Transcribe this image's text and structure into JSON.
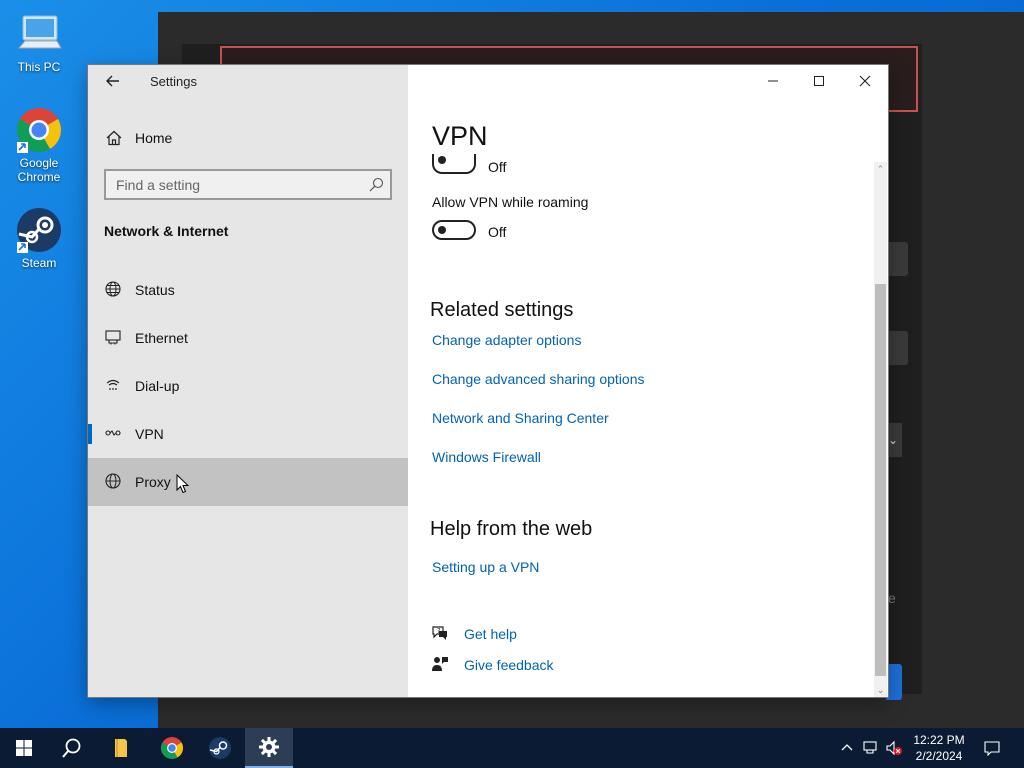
{
  "desktop": {
    "icons": [
      {
        "label": "This PC",
        "icon": "this-pc-icon"
      },
      {
        "label": "Google Chrome",
        "icon": "chrome-icon"
      },
      {
        "label": "Steam",
        "icon": "steam-icon"
      }
    ]
  },
  "window": {
    "title": "Settings",
    "back_icon": "back-arrow-icon",
    "controls": [
      "minimize",
      "maximize",
      "close"
    ]
  },
  "sidebar": {
    "home_label": "Home",
    "search_placeholder": "Find a setting",
    "section_header": "Network & Internet",
    "items": [
      {
        "label": "Status",
        "icon": "globe-status-icon"
      },
      {
        "label": "Ethernet",
        "icon": "ethernet-icon"
      },
      {
        "label": "Dial-up",
        "icon": "dialup-icon"
      },
      {
        "label": "VPN",
        "icon": "vpn-icon",
        "selected": true
      },
      {
        "label": "Proxy",
        "icon": "globe-icon",
        "hovered": true
      }
    ]
  },
  "content": {
    "page_title": "VPN",
    "toggle1_state": "Off",
    "allow_roaming_label": "Allow VPN while roaming",
    "toggle2_state": "Off",
    "related_header": "Related settings",
    "related_links": [
      "Change adapter options",
      "Change advanced sharing options",
      "Network and Sharing Center",
      "Windows Firewall"
    ],
    "help_header": "Help from the web",
    "help_links": [
      "Setting up a VPN"
    ],
    "get_help": "Get help",
    "give_feedback": "Give feedback"
  },
  "taskbar": {
    "time": "12:22 PM",
    "date": "2/2/2024"
  },
  "colors": {
    "accent": "#0067c0",
    "link": "#0063b1",
    "sidebar_bg": "#e6e6e6",
    "hover_bg": "#c2c2c2",
    "taskbar_bg": "#0b1b33"
  }
}
